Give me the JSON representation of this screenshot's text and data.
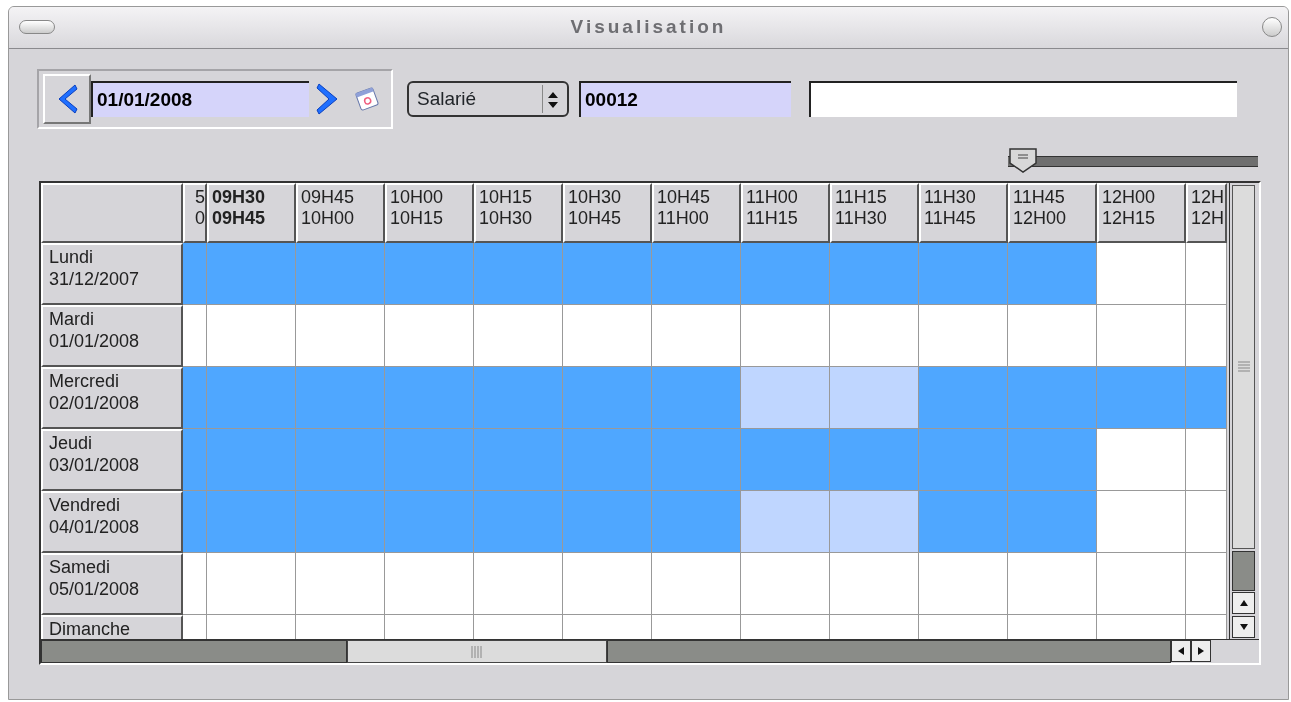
{
  "window": {
    "title": "Visualisation"
  },
  "toolbar": {
    "date": "01/01/2008",
    "type_select": "Salarié",
    "code": "00012"
  },
  "zoom_slider": {
    "level": 0
  },
  "schedule": {
    "columns": [
      {
        "lines": [
          "5",
          "0"
        ],
        "selected": false
      },
      {
        "lines": [
          "09H30",
          "09H45"
        ],
        "selected": true
      },
      {
        "lines": [
          "09H45",
          "10H00"
        ],
        "selected": false
      },
      {
        "lines": [
          "10H00",
          "10H15"
        ],
        "selected": false
      },
      {
        "lines": [
          "10H15",
          "10H30"
        ],
        "selected": false
      },
      {
        "lines": [
          "10H30",
          "10H45"
        ],
        "selected": false
      },
      {
        "lines": [
          "10H45",
          "11H00"
        ],
        "selected": false
      },
      {
        "lines": [
          "11H00",
          "11H15"
        ],
        "selected": false
      },
      {
        "lines": [
          "11H15",
          "11H30"
        ],
        "selected": false
      },
      {
        "lines": [
          "11H30",
          "11H45"
        ],
        "selected": false
      },
      {
        "lines": [
          "11H45",
          "12H00"
        ],
        "selected": false
      },
      {
        "lines": [
          "12H00",
          "12H15"
        ],
        "selected": false
      },
      {
        "lines": [
          "12H",
          "12H"
        ],
        "selected": false
      }
    ],
    "rows": [
      {
        "day": "Lundi",
        "date": "31/12/2007",
        "slots": [
          {
            "kind": "busy"
          },
          {
            "kind": "busy"
          },
          {
            "kind": "busy"
          },
          {
            "kind": "busy"
          },
          {
            "kind": "busy"
          },
          {
            "kind": "busy"
          },
          {
            "kind": "busy"
          },
          {
            "kind": "busy"
          },
          {
            "kind": "busy"
          },
          {
            "kind": "busy"
          },
          {
            "kind": "busy"
          },
          {
            "kind": "free"
          },
          {
            "kind": "free"
          }
        ]
      },
      {
        "day": "Mardi",
        "date": "01/01/2008",
        "slots": [
          {
            "kind": "free"
          },
          {
            "kind": "free"
          },
          {
            "kind": "free"
          },
          {
            "kind": "free"
          },
          {
            "kind": "free"
          },
          {
            "kind": "free"
          },
          {
            "kind": "free"
          },
          {
            "kind": "free"
          },
          {
            "kind": "free"
          },
          {
            "kind": "free"
          },
          {
            "kind": "free"
          },
          {
            "kind": "free"
          },
          {
            "kind": "free"
          }
        ]
      },
      {
        "day": "Mercredi",
        "date": "02/01/2008",
        "slots": [
          {
            "kind": "busy"
          },
          {
            "kind": "busy"
          },
          {
            "kind": "busy"
          },
          {
            "kind": "busy"
          },
          {
            "kind": "busy"
          },
          {
            "kind": "busy"
          },
          {
            "kind": "busy"
          },
          {
            "kind": "partial"
          },
          {
            "kind": "partial"
          },
          {
            "kind": "busy"
          },
          {
            "kind": "busy"
          },
          {
            "kind": "busy"
          },
          {
            "kind": "busy"
          }
        ]
      },
      {
        "day": "Jeudi",
        "date": "03/01/2008",
        "slots": [
          {
            "kind": "busy"
          },
          {
            "kind": "busy"
          },
          {
            "kind": "busy"
          },
          {
            "kind": "busy"
          },
          {
            "kind": "busy"
          },
          {
            "kind": "busy"
          },
          {
            "kind": "busy"
          },
          {
            "kind": "busy"
          },
          {
            "kind": "busy"
          },
          {
            "kind": "busy"
          },
          {
            "kind": "busy"
          },
          {
            "kind": "free"
          },
          {
            "kind": "free"
          }
        ]
      },
      {
        "day": "Vendredi",
        "date": "04/01/2008",
        "slots": [
          {
            "kind": "busy"
          },
          {
            "kind": "busy"
          },
          {
            "kind": "busy"
          },
          {
            "kind": "busy"
          },
          {
            "kind": "busy"
          },
          {
            "kind": "busy"
          },
          {
            "kind": "busy"
          },
          {
            "kind": "partial"
          },
          {
            "kind": "partial"
          },
          {
            "kind": "busy"
          },
          {
            "kind": "busy"
          },
          {
            "kind": "free"
          },
          {
            "kind": "free"
          }
        ]
      },
      {
        "day": "Samedi",
        "date": "05/01/2008",
        "slots": [
          {
            "kind": "free"
          },
          {
            "kind": "free"
          },
          {
            "kind": "free"
          },
          {
            "kind": "free"
          },
          {
            "kind": "free"
          },
          {
            "kind": "free"
          },
          {
            "kind": "free"
          },
          {
            "kind": "free"
          },
          {
            "kind": "free"
          },
          {
            "kind": "free"
          },
          {
            "kind": "free"
          },
          {
            "kind": "free"
          },
          {
            "kind": "free"
          }
        ]
      },
      {
        "day": "Dimanche",
        "slots": [
          {
            "kind": "free"
          },
          {
            "kind": "free"
          },
          {
            "kind": "free"
          },
          {
            "kind": "free"
          },
          {
            "kind": "free"
          },
          {
            "kind": "free"
          },
          {
            "kind": "free"
          },
          {
            "kind": "free"
          },
          {
            "kind": "free"
          },
          {
            "kind": "free"
          },
          {
            "kind": "free"
          },
          {
            "kind": "free"
          },
          {
            "kind": "free"
          }
        ]
      }
    ]
  }
}
